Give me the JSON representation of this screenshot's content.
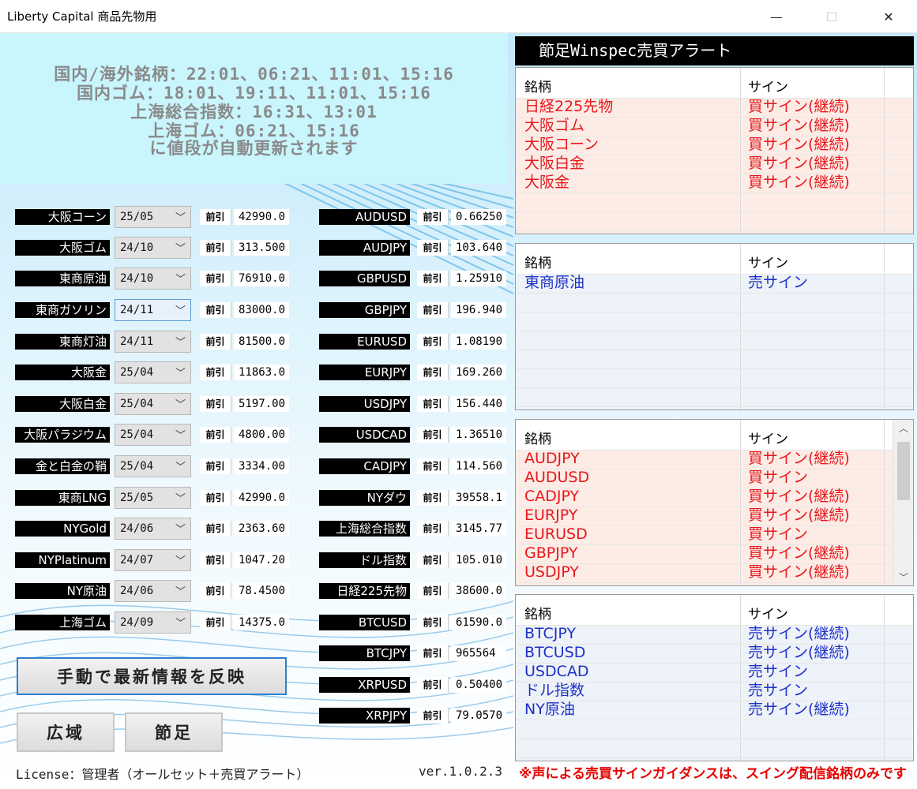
{
  "window": {
    "title": "Liberty Capital 商品先物用",
    "minimize": "—",
    "maximize": "☐",
    "close": "✕"
  },
  "notice": {
    "lines": [
      "国内/海外銘柄：22:01、06:21、11:01、15:16",
      "国内ゴム：18:01、19:11、11:01、15:16",
      "上海総合指数：16:31、13:01",
      "上海ゴム：06:21、15:16",
      "に値段が自動更新されます"
    ]
  },
  "prev_label": "前引",
  "domestic": [
    {
      "name": "大阪コーン",
      "month": "25/05",
      "price": "42990.0"
    },
    {
      "name": "大阪ゴム",
      "month": "24/10",
      "price": "313.500"
    },
    {
      "name": "東商原油",
      "month": "24/10",
      "price": "76910.0"
    },
    {
      "name": "東商ガソリン",
      "month": "24/11",
      "price": "83000.0"
    },
    {
      "name": "東商灯油",
      "month": "24/11",
      "price": "81500.0"
    },
    {
      "name": "大阪金",
      "month": "25/04",
      "price": "11863.0"
    },
    {
      "name": "大阪白金",
      "month": "25/04",
      "price": "5197.00"
    },
    {
      "name": "大阪パラジウム",
      "month": "25/04",
      "price": "4800.00"
    },
    {
      "name": "金と白金の鞘",
      "month": "25/04",
      "price": "3334.00"
    },
    {
      "name": "東商LNG",
      "month": "25/05",
      "price": "42990.0"
    },
    {
      "name": "NYGold",
      "month": "24/06",
      "price": "2363.60"
    },
    {
      "name": "NYPlatinum",
      "month": "24/07",
      "price": "1047.20"
    },
    {
      "name": "NY原油",
      "month": "24/06",
      "price": "78.4500"
    },
    {
      "name": "上海ゴム",
      "month": "24/09",
      "price": "14375.0"
    }
  ],
  "overseas": [
    {
      "name": "AUDUSD",
      "price": "0.66250"
    },
    {
      "name": "AUDJPY",
      "price": "103.640"
    },
    {
      "name": "GBPUSD",
      "price": "1.25910"
    },
    {
      "name": "GBPJPY",
      "price": "196.940"
    },
    {
      "name": "EURUSD",
      "price": "1.08190"
    },
    {
      "name": "EURJPY",
      "price": "169.260"
    },
    {
      "name": "USDJPY",
      "price": "156.440"
    },
    {
      "name": "USDCAD",
      "price": "1.36510"
    },
    {
      "name": "CADJPY",
      "price": "114.560"
    },
    {
      "name": "NYダウ",
      "price": "39558.1"
    },
    {
      "name": "上海総合指数",
      "price": "3145.77"
    },
    {
      "name": "ドル指数",
      "price": "105.010"
    },
    {
      "name": "日経225先物",
      "price": "38600.0"
    },
    {
      "name": "BTCUSD",
      "price": "61590.0"
    },
    {
      "name": "BTCJPY",
      "price": "965564"
    },
    {
      "name": "XRPUSD",
      "price": "0.50400"
    },
    {
      "name": "XRPJPY",
      "price": "79.0570"
    }
  ],
  "buttons": {
    "refresh": "手動で最新情報を反映",
    "wide": "広域",
    "setsu": "節足"
  },
  "footer": {
    "license": "License：管理者（オールセット＋売買アラート）",
    "version": "ver.1.0.2.3",
    "warning": "※声による売買サインガイダンスは、スイング配信銘柄のみです"
  },
  "alert": {
    "title": "節足Winspec売買アラート",
    "col_name": "銘柄",
    "col_sign": "サイン",
    "panels": [
      {
        "color": "red",
        "rows": [
          {
            "name": "日経225先物",
            "sign": "買サイン(継続)"
          },
          {
            "name": "大阪ゴム",
            "sign": "買サイン(継続)"
          },
          {
            "name": "大阪コーン",
            "sign": "買サイン(継続)"
          },
          {
            "name": "大阪白金",
            "sign": "買サイン(継続)"
          },
          {
            "name": "大阪金",
            "sign": "買サイン(継続)"
          }
        ]
      },
      {
        "color": "blue",
        "rows": [
          {
            "name": "東商原油",
            "sign": "売サイン"
          }
        ]
      },
      {
        "color": "red",
        "rows": [
          {
            "name": "AUDJPY",
            "sign": "買サイン(継続)"
          },
          {
            "name": "AUDUSD",
            "sign": "買サイン"
          },
          {
            "name": "CADJPY",
            "sign": "買サイン(継続)"
          },
          {
            "name": "EURJPY",
            "sign": "買サイン(継続)"
          },
          {
            "name": "EURUSD",
            "sign": "買サイン"
          },
          {
            "name": "GBPJPY",
            "sign": "買サイン(継続)"
          },
          {
            "name": "USDJPY",
            "sign": "買サイン(継続)"
          }
        ]
      },
      {
        "color": "blue",
        "rows": [
          {
            "name": "BTCJPY",
            "sign": "売サイン(継続)"
          },
          {
            "name": "BTCUSD",
            "sign": "売サイン(継続)"
          },
          {
            "name": "USDCAD",
            "sign": "売サイン"
          },
          {
            "name": "ドル指数",
            "sign": "売サイン"
          },
          {
            "name": "NY原油",
            "sign": "売サイン(継続)"
          }
        ]
      }
    ]
  },
  "colors": {
    "red": "#e8171c",
    "blue": "#1d32c8",
    "red_row_bg": "#fdece6",
    "blue_row_bg": "#eef2f9"
  },
  "icons": {
    "dropdown": "chevron-down-icon",
    "scroll_up": "scroll-up-arrow-icon",
    "scroll_down": "scroll-down-arrow-icon"
  }
}
